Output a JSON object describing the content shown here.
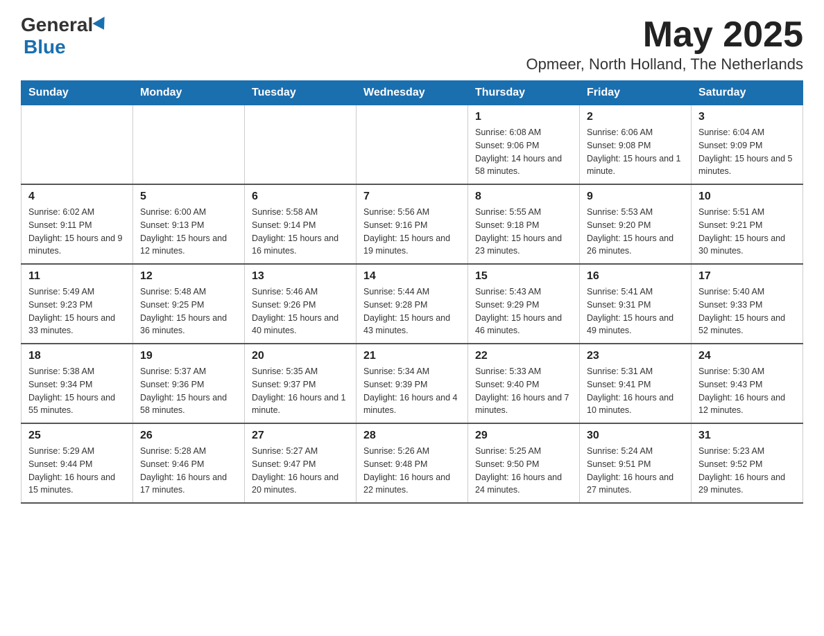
{
  "header": {
    "logo_general": "General",
    "logo_blue": "Blue",
    "month": "May 2025",
    "location": "Opmeer, North Holland, The Netherlands"
  },
  "days_of_week": [
    "Sunday",
    "Monday",
    "Tuesday",
    "Wednesday",
    "Thursday",
    "Friday",
    "Saturday"
  ],
  "weeks": [
    {
      "days": [
        {
          "number": "",
          "info": ""
        },
        {
          "number": "",
          "info": ""
        },
        {
          "number": "",
          "info": ""
        },
        {
          "number": "",
          "info": ""
        },
        {
          "number": "1",
          "info": "Sunrise: 6:08 AM\nSunset: 9:06 PM\nDaylight: 14 hours and 58 minutes."
        },
        {
          "number": "2",
          "info": "Sunrise: 6:06 AM\nSunset: 9:08 PM\nDaylight: 15 hours and 1 minute."
        },
        {
          "number": "3",
          "info": "Sunrise: 6:04 AM\nSunset: 9:09 PM\nDaylight: 15 hours and 5 minutes."
        }
      ]
    },
    {
      "days": [
        {
          "number": "4",
          "info": "Sunrise: 6:02 AM\nSunset: 9:11 PM\nDaylight: 15 hours and 9 minutes."
        },
        {
          "number": "5",
          "info": "Sunrise: 6:00 AM\nSunset: 9:13 PM\nDaylight: 15 hours and 12 minutes."
        },
        {
          "number": "6",
          "info": "Sunrise: 5:58 AM\nSunset: 9:14 PM\nDaylight: 15 hours and 16 minutes."
        },
        {
          "number": "7",
          "info": "Sunrise: 5:56 AM\nSunset: 9:16 PM\nDaylight: 15 hours and 19 minutes."
        },
        {
          "number": "8",
          "info": "Sunrise: 5:55 AM\nSunset: 9:18 PM\nDaylight: 15 hours and 23 minutes."
        },
        {
          "number": "9",
          "info": "Sunrise: 5:53 AM\nSunset: 9:20 PM\nDaylight: 15 hours and 26 minutes."
        },
        {
          "number": "10",
          "info": "Sunrise: 5:51 AM\nSunset: 9:21 PM\nDaylight: 15 hours and 30 minutes."
        }
      ]
    },
    {
      "days": [
        {
          "number": "11",
          "info": "Sunrise: 5:49 AM\nSunset: 9:23 PM\nDaylight: 15 hours and 33 minutes."
        },
        {
          "number": "12",
          "info": "Sunrise: 5:48 AM\nSunset: 9:25 PM\nDaylight: 15 hours and 36 minutes."
        },
        {
          "number": "13",
          "info": "Sunrise: 5:46 AM\nSunset: 9:26 PM\nDaylight: 15 hours and 40 minutes."
        },
        {
          "number": "14",
          "info": "Sunrise: 5:44 AM\nSunset: 9:28 PM\nDaylight: 15 hours and 43 minutes."
        },
        {
          "number": "15",
          "info": "Sunrise: 5:43 AM\nSunset: 9:29 PM\nDaylight: 15 hours and 46 minutes."
        },
        {
          "number": "16",
          "info": "Sunrise: 5:41 AM\nSunset: 9:31 PM\nDaylight: 15 hours and 49 minutes."
        },
        {
          "number": "17",
          "info": "Sunrise: 5:40 AM\nSunset: 9:33 PM\nDaylight: 15 hours and 52 minutes."
        }
      ]
    },
    {
      "days": [
        {
          "number": "18",
          "info": "Sunrise: 5:38 AM\nSunset: 9:34 PM\nDaylight: 15 hours and 55 minutes."
        },
        {
          "number": "19",
          "info": "Sunrise: 5:37 AM\nSunset: 9:36 PM\nDaylight: 15 hours and 58 minutes."
        },
        {
          "number": "20",
          "info": "Sunrise: 5:35 AM\nSunset: 9:37 PM\nDaylight: 16 hours and 1 minute."
        },
        {
          "number": "21",
          "info": "Sunrise: 5:34 AM\nSunset: 9:39 PM\nDaylight: 16 hours and 4 minutes."
        },
        {
          "number": "22",
          "info": "Sunrise: 5:33 AM\nSunset: 9:40 PM\nDaylight: 16 hours and 7 minutes."
        },
        {
          "number": "23",
          "info": "Sunrise: 5:31 AM\nSunset: 9:41 PM\nDaylight: 16 hours and 10 minutes."
        },
        {
          "number": "24",
          "info": "Sunrise: 5:30 AM\nSunset: 9:43 PM\nDaylight: 16 hours and 12 minutes."
        }
      ]
    },
    {
      "days": [
        {
          "number": "25",
          "info": "Sunrise: 5:29 AM\nSunset: 9:44 PM\nDaylight: 16 hours and 15 minutes."
        },
        {
          "number": "26",
          "info": "Sunrise: 5:28 AM\nSunset: 9:46 PM\nDaylight: 16 hours and 17 minutes."
        },
        {
          "number": "27",
          "info": "Sunrise: 5:27 AM\nSunset: 9:47 PM\nDaylight: 16 hours and 20 minutes."
        },
        {
          "number": "28",
          "info": "Sunrise: 5:26 AM\nSunset: 9:48 PM\nDaylight: 16 hours and 22 minutes."
        },
        {
          "number": "29",
          "info": "Sunrise: 5:25 AM\nSunset: 9:50 PM\nDaylight: 16 hours and 24 minutes."
        },
        {
          "number": "30",
          "info": "Sunrise: 5:24 AM\nSunset: 9:51 PM\nDaylight: 16 hours and 27 minutes."
        },
        {
          "number": "31",
          "info": "Sunrise: 5:23 AM\nSunset: 9:52 PM\nDaylight: 16 hours and 29 minutes."
        }
      ]
    }
  ]
}
